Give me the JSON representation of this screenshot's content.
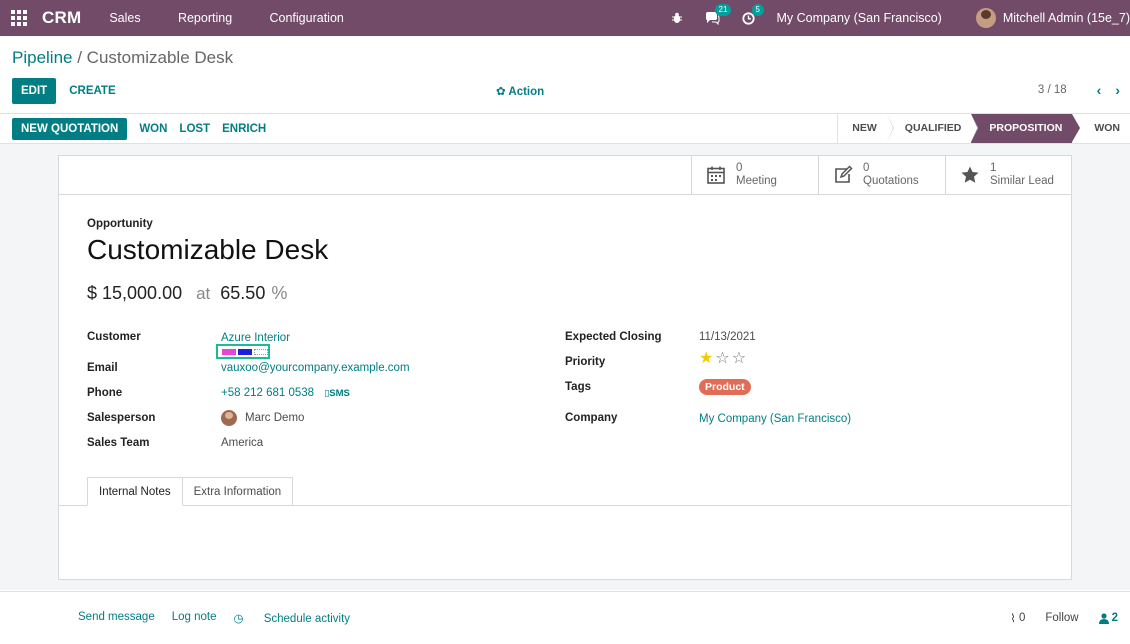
{
  "topbar": {
    "app_name": "CRM",
    "menu": [
      "Sales",
      "Reporting",
      "Configuration"
    ],
    "messages_count": "21",
    "activities_count": "5",
    "company": "My Company (San Francisco)",
    "user": "Mitchell Admin (15e_7)",
    "bar_color": "#714b67"
  },
  "breadcrumb": {
    "parent": "Pipeline",
    "separator": " / ",
    "current": "Customizable Desk"
  },
  "control_panel": {
    "edit_label": "EDIT",
    "create_label": "CREATE",
    "action_label": "Action",
    "pager_value": "3 / 18"
  },
  "statusbar": {
    "new_quotation": "NEW QUOTATION",
    "won": "WON",
    "lost": "LOST",
    "enrich": "ENRICH",
    "stages": [
      "NEW",
      "QUALIFIED",
      "PROPOSITION",
      "WON"
    ],
    "active_stage": "PROPOSITION"
  },
  "smart_buttons": [
    {
      "count": "0",
      "label": "Meeting",
      "icon": "calendar-icon"
    },
    {
      "count": "0",
      "label": "Quotations",
      "icon": "edit-icon"
    },
    {
      "count": "1",
      "label": "Similar Lead",
      "icon": "star-icon"
    }
  ],
  "opportunity": {
    "kind_label": "Opportunity",
    "name": "Customizable Desk",
    "revenue": "$ 15,000.00",
    "at_label": "at",
    "probability": "65.50",
    "percent_sign": "%"
  },
  "left_fields": {
    "customer_label": "Customer",
    "customer": "Azure Interior",
    "email_label": "Email",
    "email": "vauxoo@yourcompany.example.com",
    "phone_label": "Phone",
    "phone": "+58 212 681 0538",
    "sms_label": "SMS",
    "salesperson_label": "Salesperson",
    "salesperson": "Marc Demo",
    "sales_team_label": "Sales Team",
    "sales_team": "America"
  },
  "right_fields": {
    "expected_closing_label": "Expected Closing",
    "expected_closing": "11/13/2021",
    "priority_label": "Priority",
    "priority_stars": 1,
    "priority_max": 3,
    "tags_label": "Tags",
    "tag": "Product",
    "tag_color": "#e06d55",
    "company_label": "Company",
    "company": "My Company (San Francisco)"
  },
  "tabs": [
    "Internal Notes",
    "Extra Information"
  ],
  "chatter": {
    "send_message": "Send message",
    "log_note": "Log note",
    "schedule_activity": "Schedule activity",
    "attachments": "0",
    "follow": "Follow",
    "followers": "2"
  },
  "colors": {
    "accent": "#017e84",
    "brand": "#714b67"
  }
}
